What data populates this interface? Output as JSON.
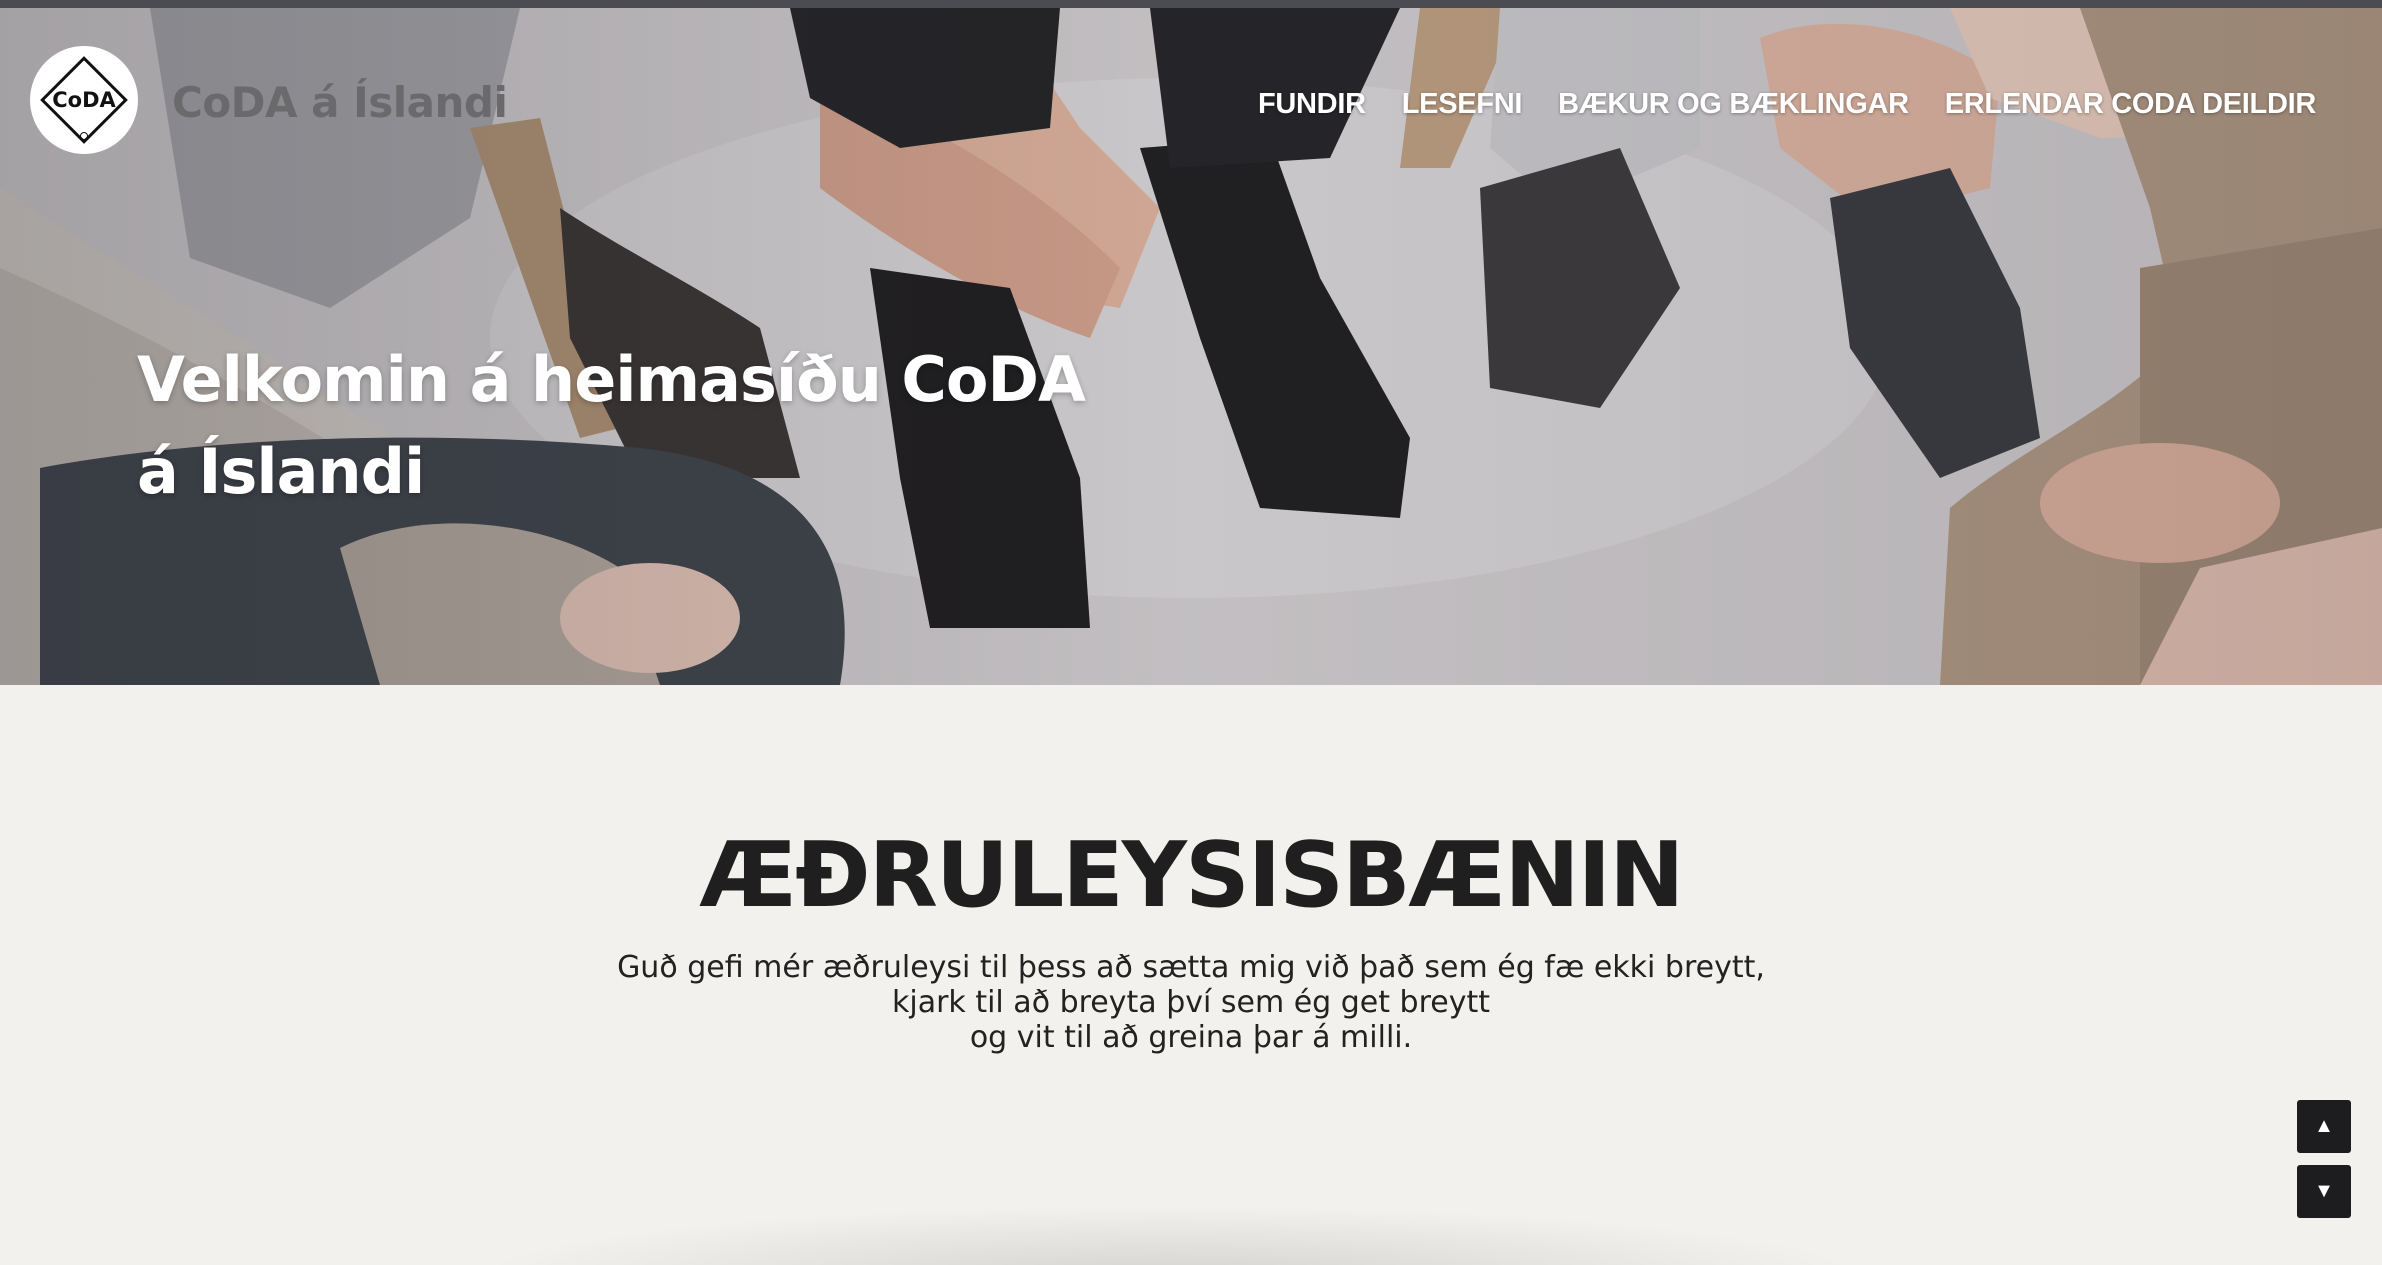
{
  "header": {
    "logo_text": "CoDA",
    "site_name": "CoDA á Íslandi",
    "nav": [
      {
        "label": "FUNDIR"
      },
      {
        "label": "LESEFNI"
      },
      {
        "label": "BÆKUR OG BÆKLINGAR"
      },
      {
        "label": "ERLENDAR CODA DEILDIR"
      }
    ]
  },
  "hero": {
    "title_line1": "Velkomin á heimasíðu CoDA",
    "title_line2": "á Íslandi"
  },
  "main": {
    "heading": "ÆÐRULEYSISBÆNIN",
    "lines": [
      "Guð gefi mér æðruleysi til þess að sætta mig við það sem ég fæ ekki breytt,",
      "kjark til að breyta því sem ég get breytt",
      "og vit til að greina þar á milli."
    ]
  },
  "controls": {
    "scroll_up_icon": "triangle-up-icon",
    "scroll_down_icon": "triangle-down-icon"
  },
  "colors": {
    "background": "#f2f1ed",
    "heading": "#1f1f1f",
    "button": "#1d1d1f",
    "nav_text": "#ffffff"
  }
}
